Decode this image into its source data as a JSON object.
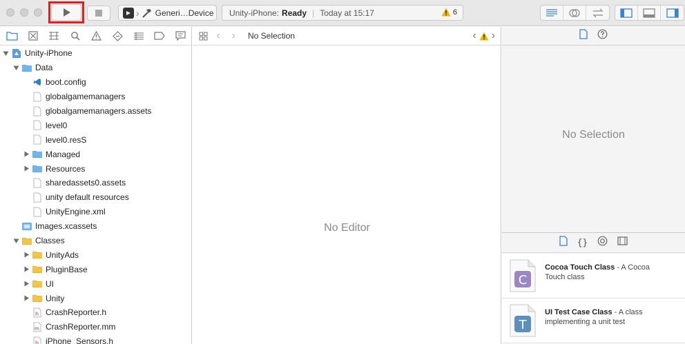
{
  "toolbar": {
    "scheme_name": "Generi…Device",
    "activity_app": "Unity-iPhone:",
    "activity_status": "Ready",
    "activity_time": "Today at 15:17",
    "warning_count": "6"
  },
  "navigator": {
    "tabs": [
      "folder-icon",
      "source-control-icon",
      "symbol-icon",
      "search-icon",
      "issue-icon",
      "test-icon",
      "debug-icon",
      "breakpoint-icon",
      "report-icon"
    ],
    "tree": [
      {
        "label": "Unity-iPhone",
        "depth": 0,
        "type": "project",
        "disclosure": "open"
      },
      {
        "label": "Data",
        "depth": 1,
        "type": "folder-blue",
        "disclosure": "open"
      },
      {
        "label": "boot.config",
        "depth": 2,
        "type": "vscode",
        "disclosure": "none"
      },
      {
        "label": "globalgamemanagers",
        "depth": 2,
        "type": "file",
        "disclosure": "none"
      },
      {
        "label": "globalgamemanagers.assets",
        "depth": 2,
        "type": "file",
        "disclosure": "none"
      },
      {
        "label": "level0",
        "depth": 2,
        "type": "file",
        "disclosure": "none"
      },
      {
        "label": "level0.resS",
        "depth": 2,
        "type": "file",
        "disclosure": "none"
      },
      {
        "label": "Managed",
        "depth": 2,
        "type": "folder-blue",
        "disclosure": "closed"
      },
      {
        "label": "Resources",
        "depth": 2,
        "type": "folder-blue",
        "disclosure": "closed"
      },
      {
        "label": "sharedassets0.assets",
        "depth": 2,
        "type": "file",
        "disclosure": "none"
      },
      {
        "label": "unity default resources",
        "depth": 2,
        "type": "file",
        "disclosure": "none"
      },
      {
        "label": "UnityEngine.xml",
        "depth": 2,
        "type": "file",
        "disclosure": "none"
      },
      {
        "label": "Images.xcassets",
        "depth": 1,
        "type": "assets",
        "disclosure": "none"
      },
      {
        "label": "Classes",
        "depth": 1,
        "type": "folder-yellow",
        "disclosure": "open"
      },
      {
        "label": "UnityAds",
        "depth": 2,
        "type": "folder-yellow",
        "disclosure": "closed"
      },
      {
        "label": "PluginBase",
        "depth": 2,
        "type": "folder-yellow",
        "disclosure": "closed"
      },
      {
        "label": "UI",
        "depth": 2,
        "type": "folder-yellow",
        "disclosure": "closed"
      },
      {
        "label": "Unity",
        "depth": 2,
        "type": "folder-yellow",
        "disclosure": "closed"
      },
      {
        "label": "CrashReporter.h",
        "depth": 2,
        "type": "header",
        "disclosure": "none"
      },
      {
        "label": "CrashReporter.mm",
        "depth": 2,
        "type": "objc",
        "disclosure": "none"
      },
      {
        "label": "iPhone_Sensors.h",
        "depth": 2,
        "type": "header",
        "disclosure": "none"
      }
    ]
  },
  "editor": {
    "jump_label": "No Selection",
    "empty_label": "No Editor"
  },
  "inspector": {
    "empty_label": "No Selection",
    "library": [
      {
        "title": "Cocoa Touch Class",
        "desc": " - A Cocoa Touch class",
        "letter": "C",
        "color": "#9b86c6"
      },
      {
        "title": "UI Test Case Class",
        "desc": " - A class implementing a unit test",
        "letter": "T",
        "color": "#5b8fbd"
      }
    ]
  },
  "colors": {
    "accent": "#3b82d6",
    "highlight": "#e02020",
    "folder_blue": "#6fb6ee",
    "folder_yellow": "#f5c542",
    "warning": "#f0b400"
  }
}
